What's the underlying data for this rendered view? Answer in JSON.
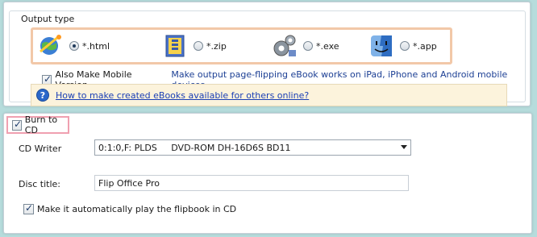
{
  "output_type": {
    "title": "Output type",
    "options": [
      {
        "label": "*.html",
        "icon": "globe-icon",
        "checked": true
      },
      {
        "label": "*.zip",
        "icon": "zip-archive-icon",
        "checked": false
      },
      {
        "label": "*.exe",
        "icon": "gears-icon",
        "checked": false
      },
      {
        "label": "*.app",
        "icon": "mac-finder-icon",
        "checked": false
      }
    ],
    "mobile_checkbox_label": "Also Make Mobile Version",
    "mobile_note": "Make output page-flipping eBook works on iPad, iPhone and Android mobile devices",
    "help_link": "How to make created eBooks available for others online?"
  },
  "burn": {
    "checkbox_label": "Burn to CD",
    "cd_writer_label": "CD Writer",
    "cd_writer_value": "0:1:0,F: PLDS     DVD-ROM DH-16D6S BD11",
    "disc_title_label": "Disc title:",
    "disc_title_value": "Flip Office Pro",
    "autoplay_label": "Make it automatically play the flipbook in CD"
  },
  "colors": {
    "background": "#b6dcdc",
    "highlight_border": "#f2c8a8",
    "burn_highlight_border": "#f0a0b0",
    "link": "#1a3fb5",
    "info_bar": "#fcf3dc"
  }
}
